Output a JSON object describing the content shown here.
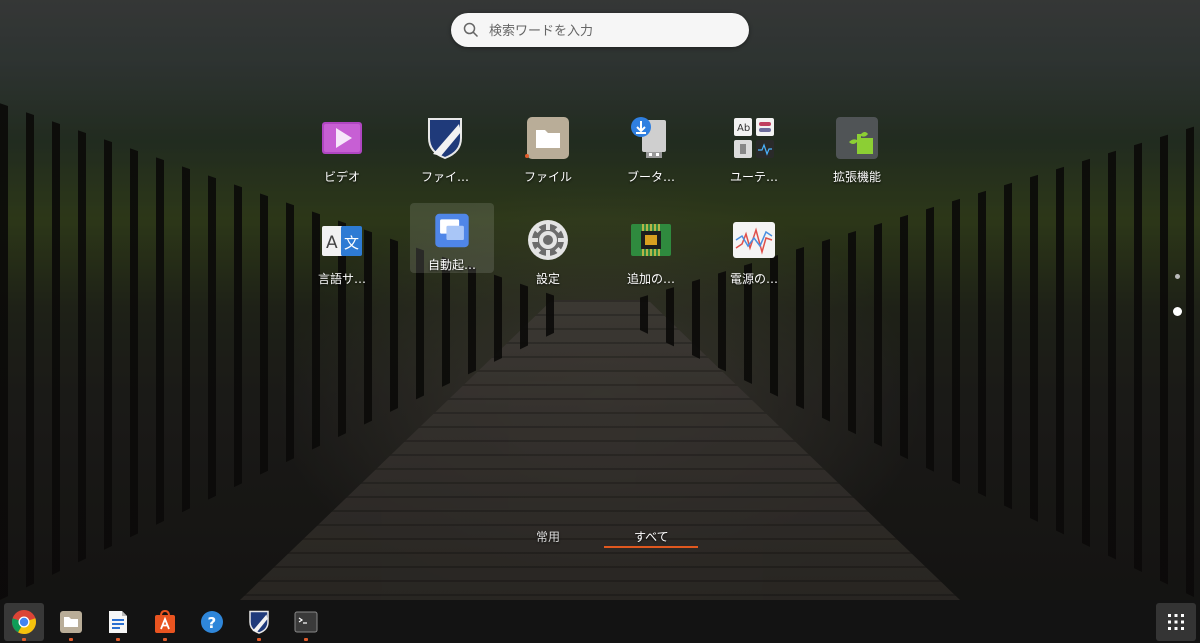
{
  "search": {
    "placeholder": "検索ワードを入力"
  },
  "apps": [
    {
      "label": "ビデオ",
      "icon": "video-icon"
    },
    {
      "label": "ファイ…",
      "icon": "shield-icon"
    },
    {
      "label": "ファイル",
      "icon": "folder-icon"
    },
    {
      "label": "ブータ…",
      "icon": "usb-download-icon"
    },
    {
      "label": "ユーテ…",
      "icon": "utilities-icon"
    },
    {
      "label": "拡張機能",
      "icon": "puzzle-icon"
    },
    {
      "label": "言語サ…",
      "icon": "language-icon"
    },
    {
      "label": "自動起…",
      "icon": "windows-icon"
    },
    {
      "label": "設定",
      "icon": "gear-icon"
    },
    {
      "label": "追加の…",
      "icon": "chip-icon"
    },
    {
      "label": "電源の…",
      "icon": "power-graph-icon"
    }
  ],
  "tabs": {
    "frequent": "常用",
    "all": "すべて",
    "active": "all"
  },
  "colors": {
    "accent": "#e0581f",
    "running_dot": "#e05c2c"
  },
  "taskbar": {
    "items": [
      {
        "icon": "chrome-icon",
        "running": true,
        "active": true
      },
      {
        "icon": "folder-icon",
        "running": true
      },
      {
        "icon": "writer-icon",
        "running": true
      },
      {
        "icon": "app-store-icon",
        "running": true
      },
      {
        "icon": "help-icon",
        "running": false
      },
      {
        "icon": "shield-icon",
        "running": true
      },
      {
        "icon": "terminal-icon",
        "running": true
      }
    ],
    "launcher_icon": "grid-icon"
  }
}
